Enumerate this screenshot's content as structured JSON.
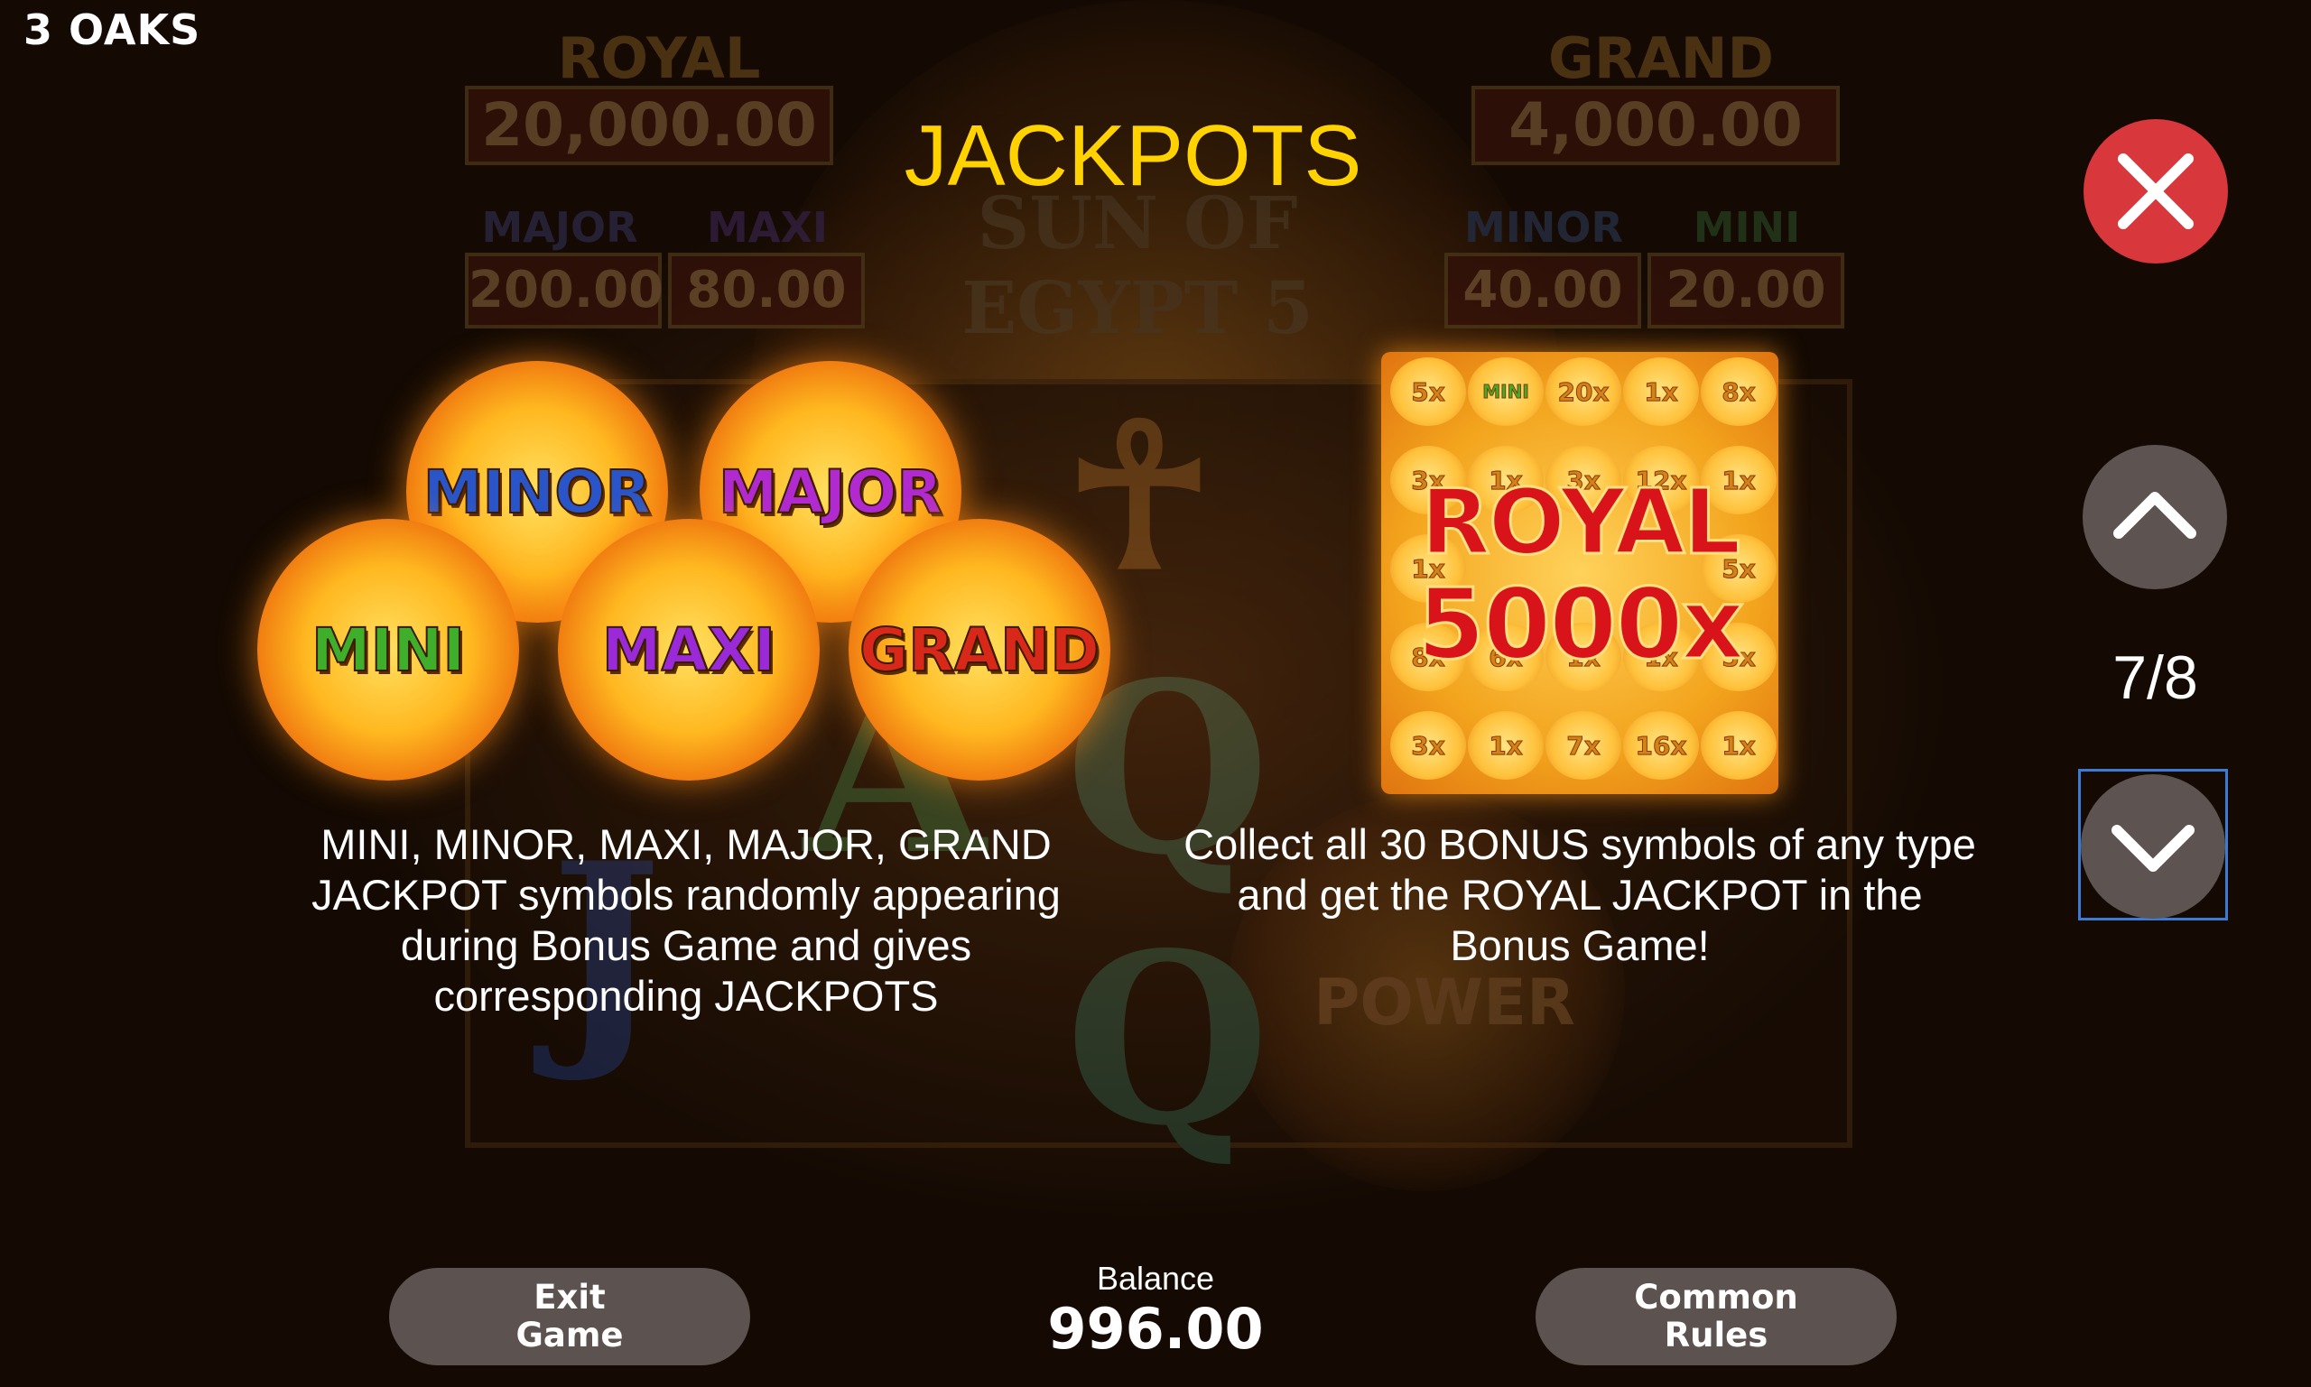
{
  "brand": {
    "logo_text": "3 OAKS"
  },
  "background": {
    "jackpot_panels": [
      {
        "label": "ROYAL",
        "value": "20,000.00"
      },
      {
        "label": "GRAND",
        "value": "4,000.00"
      },
      {
        "label": "MAJOR",
        "value": "200.00"
      },
      {
        "label": "MAXI",
        "value": "80.00"
      },
      {
        "label": "MINOR",
        "value": "40.00"
      },
      {
        "label": "MINI",
        "value": "20.00"
      }
    ],
    "game_logo_text": "SUN OF EGYPT 5",
    "power_text": "POWER"
  },
  "page": {
    "title": "JACKPOTS",
    "counter": "7/8"
  },
  "jackpot_coins": [
    "MINOR",
    "MAJOR",
    "MINI",
    "MAXI",
    "GRAND"
  ],
  "colors": {
    "title": "#ffd200",
    "close_button": "#d8373c",
    "nav_button": "#5d5451",
    "focus_outline": "#3a7bd5",
    "coin_minor": "#2a55c8",
    "coin_major": "#b02ad0",
    "coin_mini": "#3fae2a",
    "coin_maxi": "#9a2ad8",
    "coin_grand": "#d8281a"
  },
  "royal_grid": {
    "rows": [
      [
        "5x",
        "MINI",
        "20x",
        "1x",
        "8x"
      ],
      [
        "3x",
        "1x",
        "3x",
        "12x",
        "1x"
      ],
      [
        "1x",
        "",
        "",
        "",
        "5x"
      ],
      [
        "8x",
        "6x",
        "1x",
        "1x",
        "5x"
      ],
      [
        "3x",
        "1x",
        "7x",
        "16x",
        "1x"
      ]
    ],
    "headline": "ROYAL",
    "multiplier": "5000x"
  },
  "descriptions": {
    "left": "MINI, MINOR, MAXI, MAJOR, GRAND JACKPOT symbols randomly appearing during Bonus Game and gives corresponding JACKPOTS",
    "right": "Collect all 30 BONUS symbols of any type and get the ROYAL JACKPOT in the Bonus Game!"
  },
  "footer": {
    "exit_label_line1": "Exit",
    "exit_label_line2": "Game",
    "balance_label": "Balance",
    "balance_value": "996.00",
    "rules_label_line1": "Common",
    "rules_label_line2": "Rules"
  },
  "icons": {
    "close": "close-icon",
    "up": "chevron-up-icon",
    "down": "chevron-down-icon"
  }
}
